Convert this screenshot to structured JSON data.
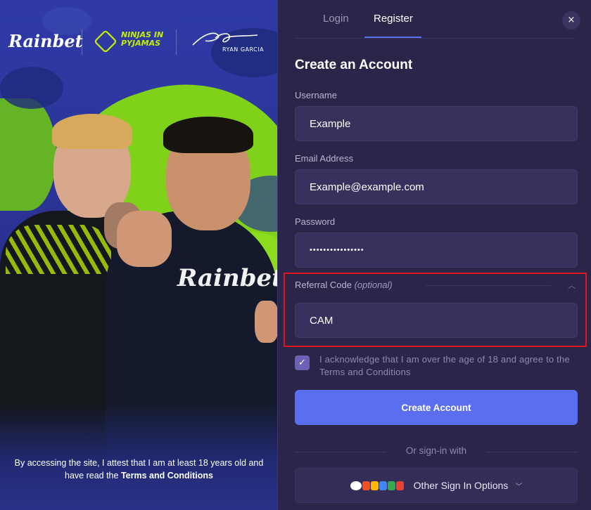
{
  "promo": {
    "brand_logo": "Rainbet",
    "partner_logo": "NINJAS IN PYJAMAS",
    "signature_name": "RYAN GARCIA",
    "shirt_logo": "Rainbet",
    "note_prefix": "By accessing the site, I attest that I am at least 18 years old and have read the ",
    "note_link": "Terms and Conditions"
  },
  "tabs": [
    {
      "label": "Login",
      "active": false
    },
    {
      "label": "Register",
      "active": true
    }
  ],
  "close_icon": "×",
  "form": {
    "title": "Create an Account",
    "username": {
      "label": "Username",
      "value": "Example"
    },
    "email": {
      "label": "Email Address",
      "value": "Example@example.com"
    },
    "password": {
      "label": "Password",
      "value": "••••••••••••••••"
    },
    "referral": {
      "label": "Referral Code",
      "optional": "(optional)",
      "value": "CAM",
      "expanded": true
    },
    "acknowledge": {
      "checked": true,
      "text": "I acknowledge that I am over the age of 18 and agree to the Terms and Conditions"
    },
    "submit_label": "Create Account",
    "divider_label": "Or sign-in with",
    "other_signin_label": "Other Sign In Options"
  },
  "colors": {
    "panel_bg": "#2b2649",
    "input_bg": "#37315e",
    "accent": "#5b6ef0",
    "highlight_box": "#e0141e",
    "lime": "#7fd11a"
  },
  "icons": {
    "close": "close-icon",
    "chevron_up": "chevron-up-icon",
    "chevron_down": "chevron-down-icon",
    "checkbox": "checkmark-icon",
    "providers": "provider-icons"
  }
}
